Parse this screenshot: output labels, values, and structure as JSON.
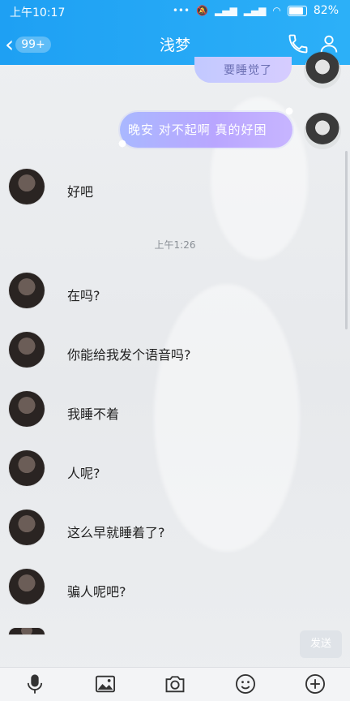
{
  "status_bar": {
    "time": "上午10:17",
    "battery": "82%"
  },
  "header": {
    "title": "浅梦",
    "back_badge": "99+"
  },
  "messages": {
    "partial_top": "要睡觉了",
    "outgoing": "晚安 对不起啊 真的好困",
    "timestamp": "上午1:26",
    "incoming": [
      "好吧",
      "在吗?",
      "你能给我发个语音吗?",
      "我睡不着",
      "人呢?",
      "这么早就睡着了?",
      "骗人呢吧?"
    ]
  },
  "composer": {
    "send_label": "发送"
  },
  "icons": {
    "back": "chevron-left-icon",
    "phone": "phone-icon",
    "profile": "user-icon",
    "mic": "microphone-icon",
    "image": "image-icon",
    "camera": "camera-icon",
    "emoji": "emoji-icon",
    "more": "plus-circle-icon"
  },
  "colors": {
    "header_bg": "#1ea0f3",
    "bubble_out": "#b9a6ff"
  }
}
